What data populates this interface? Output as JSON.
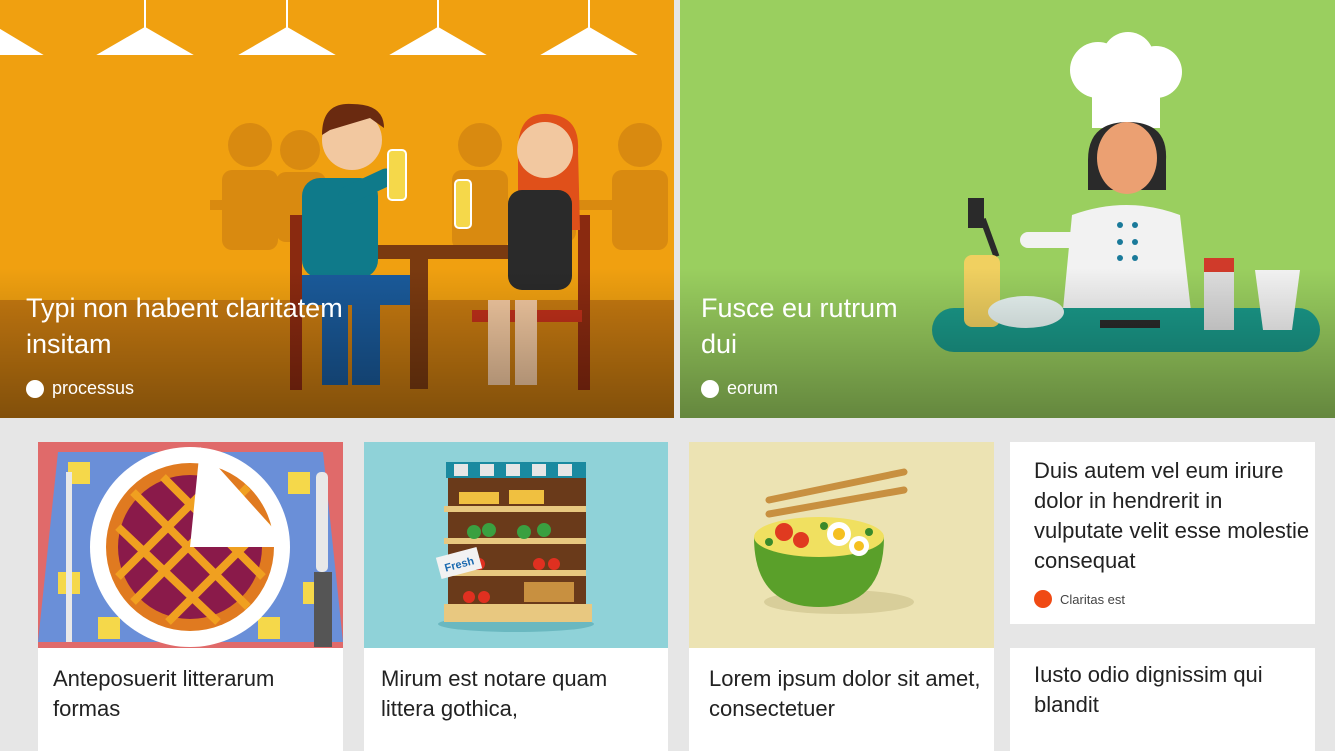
{
  "hero_left": {
    "title": "Typi non habent claritatem insitam",
    "tag": "processus",
    "bg": "#f0a010"
  },
  "hero_right": {
    "title": "Fusce eu rutrum dui",
    "tag": "eorum",
    "bg": "#9acf5f"
  },
  "cards": [
    {
      "caption": "Anteposuerit litterarum formas",
      "icon": "pie-icon"
    },
    {
      "caption": "Mirum est notare quam littera gothica,",
      "icon": "market-shelf-icon",
      "sign": "Fresh"
    },
    {
      "caption": "Lorem ipsum dolor sit amet, consectetuer",
      "icon": "noodle-bowl-icon"
    }
  ],
  "text_card": {
    "title": "Duis autem vel eum iriure dolor in hendrerit in vulputate velit esse molestie consequat",
    "tag": "Claritas est",
    "tag_color": "#f04a14"
  },
  "text_card2": {
    "title": "Iusto odio dignissim qui blandit"
  }
}
